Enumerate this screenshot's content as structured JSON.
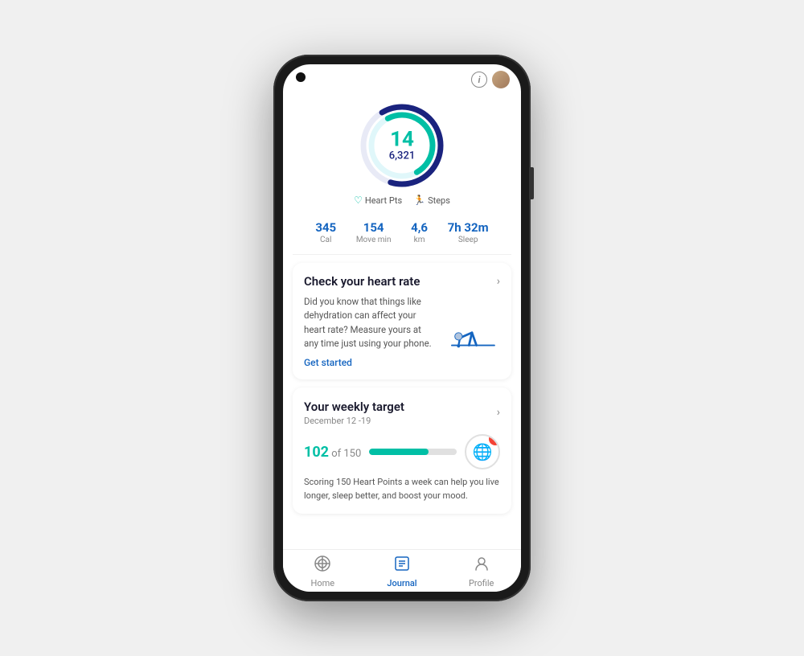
{
  "phone": {
    "camera": "camera-hole",
    "screen": {
      "header": {
        "info_icon": "i",
        "avatar_label": "user-avatar"
      },
      "ring": {
        "heart_pts_value": "14",
        "steps_value": "6,321",
        "legend": [
          {
            "icon": "♡",
            "label": "Heart Pts"
          },
          {
            "icon": "🏃",
            "label": "Steps"
          }
        ]
      },
      "stats": [
        {
          "value": "345",
          "label": "Cal"
        },
        {
          "value": "154",
          "label": "Move min"
        },
        {
          "value": "4,6",
          "label": "km"
        },
        {
          "value": "7h 32m",
          "label": "Sleep"
        }
      ],
      "heart_rate_card": {
        "title": "Check your heart rate",
        "description": "Did you know that things like dehydration can affect your heart rate? Measure yours at any time just using your phone.",
        "cta": "Get started"
      },
      "weekly_card": {
        "title": "Your weekly target",
        "date": "December 12 -19",
        "score": "102",
        "total": "150",
        "progress_pct": 68,
        "description": "Scoring 150 Heart Points a week can help you live longer, sleep better, and boost your mood.",
        "who_label": "World Health\nOrganization"
      },
      "bottom_nav": [
        {
          "icon": "⊙",
          "label": "Home",
          "active": false
        },
        {
          "icon": "☰",
          "label": "Journal",
          "active": true
        },
        {
          "icon": "👤",
          "label": "Profile",
          "active": false
        }
      ]
    }
  }
}
